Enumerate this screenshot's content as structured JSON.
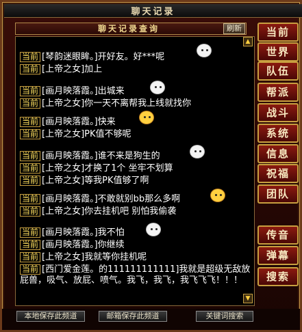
{
  "window": {
    "title": "聊天记录"
  },
  "header": {
    "query_title": "聊天记录查询",
    "refresh_label": "刷新"
  },
  "chat": {
    "tag": "当前",
    "messages": [
      {
        "text": "[琴韵迷眼眸。]开好友。好***呢"
      },
      {
        "text": "[上帝之女]加上"
      },
      {
        "text": "[画月映落霞。]出城来"
      },
      {
        "text": "[上帝之女]你一天不离帮我上线就找你"
      },
      {
        "text": "[画月映落霞。]快来"
      },
      {
        "text": "[上帝之女]PK值不够呢"
      },
      {
        "text": "[画月映落霞。]谁不来是狗生的"
      },
      {
        "text": "[上帝之女]才换了1个 坐牢不划算"
      },
      {
        "text": "[上帝之女]等我PK值够了啊"
      },
      {
        "text": "[画月映落霞。]不敢就别bb那么多啊"
      },
      {
        "text": "[上帝之女]你去挂机吧 别怕我偷袭"
      },
      {
        "text": "[画月映落霞。]我不怕"
      },
      {
        "text": "[画月映落霞。]你继续"
      },
      {
        "text": "[上帝之女]我就等你挂机呢"
      },
      {
        "text": "[西门爱金莲。的111111111111]我就是超级无敌放屁兽，吸气、放屁、喷气。我飞，我飞，我飞飞飞！！！"
      }
    ]
  },
  "tabs": [
    {
      "label": "当前"
    },
    {
      "label": "世界"
    },
    {
      "label": "队伍"
    },
    {
      "label": "帮派"
    },
    {
      "label": "战斗"
    },
    {
      "label": "系统"
    },
    {
      "label": "信息"
    },
    {
      "label": "祝福"
    },
    {
      "label": "团队"
    },
    {
      "label": "传音"
    },
    {
      "label": "弹幕"
    },
    {
      "label": "搜索"
    }
  ],
  "footer": {
    "local_save": "本地保存此频道",
    "mail_save": "邮箱保存此频道",
    "keyword_search": "关键词搜索"
  }
}
